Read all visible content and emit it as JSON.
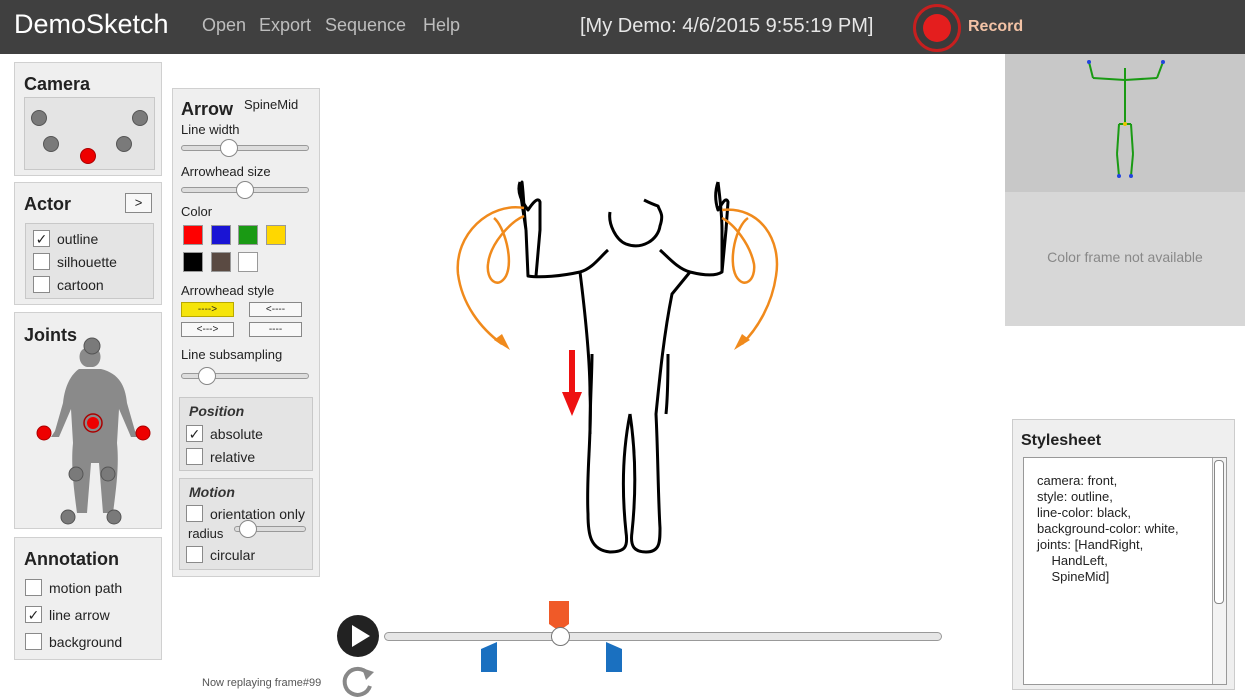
{
  "header": {
    "app_title": "DemoSketch",
    "menu": [
      "Open",
      "Export",
      "Sequence",
      "Help"
    ],
    "demo_title": "[My Demo: 4/6/2015 9:55:19 PM]",
    "record_label": "Record"
  },
  "camera": {
    "title": "Camera"
  },
  "actor": {
    "title": "Actor",
    "next_label": ">",
    "options": [
      {
        "label": "outline",
        "checked": true
      },
      {
        "label": "silhouette",
        "checked": false
      },
      {
        "label": "cartoon",
        "checked": false
      }
    ]
  },
  "joints": {
    "title": "Joints"
  },
  "annotation": {
    "title": "Annotation",
    "options": [
      {
        "label": "motion path",
        "checked": false
      },
      {
        "label": "line arrow",
        "checked": true
      },
      {
        "label": "background",
        "checked": false
      }
    ]
  },
  "arrow": {
    "title": "Arrow",
    "joint": "SpineMid",
    "line_width_label": "Line width",
    "line_width_value": 0.35,
    "arrowhead_size_label": "Arrowhead size",
    "arrowhead_size_value": 0.5,
    "color_label": "Color",
    "colors": [
      "#ff0000",
      "#1a14d4",
      "#1a9a14",
      "#ffd700",
      "#000000",
      "#5a4a42",
      "#ffffff"
    ],
    "arrowhead_style_label": "Arrowhead style",
    "styles": [
      {
        "label": "---->",
        "selected": true
      },
      {
        "label": "<----",
        "selected": false
      },
      {
        "label": "<--->",
        "selected": false
      },
      {
        "label": "----",
        "selected": false
      }
    ],
    "subsampling_label": "Line subsampling",
    "subsampling_value": 0.15,
    "position": {
      "title": "Position",
      "absolute_label": "absolute",
      "absolute_checked": true,
      "relative_label": "relative",
      "relative_checked": false
    },
    "motion": {
      "title": "Motion",
      "orientation_label": "orientation only",
      "orientation_checked": false,
      "radius_label": "radius",
      "radius_value": 0.1,
      "circular_label": "circular",
      "circular_checked": false
    }
  },
  "color_frame_text": "Color frame not available",
  "stylesheet": {
    "title": "Stylesheet",
    "content": "camera: front,\nstyle: outline,\nline-color: black,\nbackground-color: white,\njoints: [HandRight,\n    HandLeft,\n    SpineMid]"
  },
  "playback": {
    "status_text": "Now replaying frame#99",
    "progress": 0.32
  },
  "colors": {
    "accent_orange": "#f08a1c",
    "arrow_red": "#ee1111",
    "marker_blue": "#1a70c0",
    "marker_orange": "#f05a28"
  }
}
